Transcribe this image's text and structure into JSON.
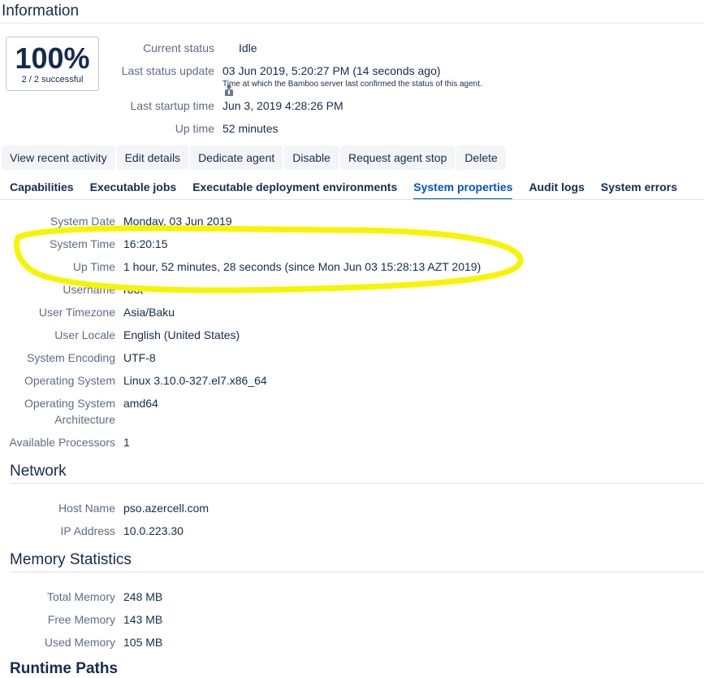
{
  "header": {
    "title": "Information"
  },
  "score": {
    "percent": "100%",
    "summary": "2 / 2 successful"
  },
  "info": {
    "current_status_label": "Current status",
    "current_status_value": "Idle",
    "last_update_label": "Last status update",
    "last_update_value": "03 Jun 2019, 5:20:27 PM (14 seconds ago)",
    "last_update_note": "Time at which the Bamboo server last confirmed the status of this agent.",
    "startup_label": "Last startup time",
    "startup_value": "Jun 3, 2019 4:28:26 PM",
    "uptime_label": "Up time",
    "uptime_value": "52 minutes"
  },
  "actions": [
    "View recent activity",
    "Edit details",
    "Dedicate agent",
    "Disable",
    "Request agent stop",
    "Delete"
  ],
  "tabs": [
    {
      "label": "Capabilities",
      "active": false
    },
    {
      "label": "Executable jobs",
      "active": false
    },
    {
      "label": "Executable deployment environments",
      "active": false
    },
    {
      "label": "System properties",
      "active": true
    },
    {
      "label": "Audit logs",
      "active": false
    },
    {
      "label": "System errors",
      "active": false
    }
  ],
  "system": [
    {
      "label": "System Date",
      "value": "Monday, 03 Jun 2019"
    },
    {
      "label": "System Time",
      "value": "16:20:15"
    },
    {
      "label": "Up Time",
      "value": "1 hour, 52 minutes, 28 seconds (since Mon Jun 03 15:28:13 AZT 2019)"
    },
    {
      "label": "Username",
      "value": "root"
    },
    {
      "label": "User Timezone",
      "value": "Asia/Baku"
    },
    {
      "label": "User Locale",
      "value": "English (United States)"
    },
    {
      "label": "System Encoding",
      "value": "UTF-8"
    },
    {
      "label": "Operating System",
      "value": "Linux 3.10.0-327.el7.x86_64"
    },
    {
      "label": "Operating System Architecture",
      "value": "amd64"
    },
    {
      "label": "Available Processors",
      "value": "1"
    }
  ],
  "network": {
    "title": "Network",
    "rows": [
      {
        "label": "Host Name",
        "value": "pso.azercell.com"
      },
      {
        "label": "IP Address",
        "value": "10.0.223.30"
      }
    ]
  },
  "memory": {
    "title": "Memory Statistics",
    "rows": [
      {
        "label": "Total Memory",
        "value": "248 MB"
      },
      {
        "label": "Free Memory",
        "value": "143 MB"
      },
      {
        "label": "Used Memory",
        "value": "105 MB"
      }
    ]
  },
  "next_section": {
    "title": "Runtime Paths"
  },
  "colors": {
    "highlight": "#f7f400",
    "link": "#0052cc"
  }
}
